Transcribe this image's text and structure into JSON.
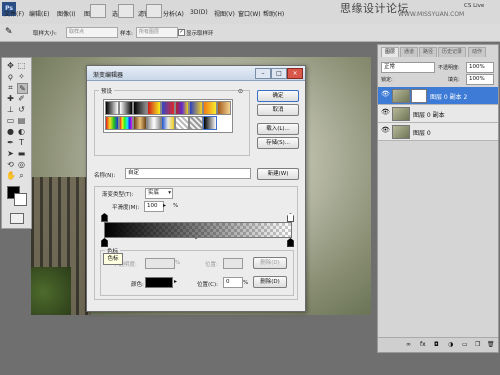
{
  "menu": [
    "文件(F)",
    "编辑(E)",
    "图像(I)",
    "图层(L)",
    "选择(S)",
    "滤镜(T)",
    "分析(A)",
    "3D(D)",
    "视图(V)",
    "窗口(W)",
    "帮助(H)"
  ],
  "watermark": {
    "main": "思缘设计论坛",
    "sub": "WWW.MISSYUAN.COM"
  },
  "cs_live": "CS Live",
  "options_bar": {
    "sample_size_label": "取样大小:",
    "sample_size_value": "取样点",
    "sample_label": "样本:",
    "sample_value": "所有图层",
    "show_ring_label": "显示取样环"
  },
  "panel": {
    "tabs": [
      "图层",
      "通道",
      "路径",
      "历史记录",
      "动作"
    ],
    "blend_mode": "正常",
    "opacity_label": "不透明度:",
    "opacity_value": "100%",
    "lock_label": "锁定:",
    "fill_label": "填充:",
    "fill_value": "100%",
    "layers": [
      {
        "name": "图层 0 副本 2",
        "selected": true
      },
      {
        "name": "图层 0 副本",
        "selected": false
      },
      {
        "name": "图层 0",
        "selected": false
      }
    ]
  },
  "dialog": {
    "title": "渐变编辑器",
    "presets_label": "预设",
    "ok": "确定",
    "cancel": "取消",
    "load": "载入(L)...",
    "save": "存储(S)...",
    "name_label": "名称(N):",
    "name_value": "自定",
    "new_button": "新建(W)",
    "gradient_type_label": "渐变类型(T):",
    "gradient_type_value": "实底",
    "smoothness_label": "平滑度(M):",
    "smoothness_value": "100",
    "smoothness_unit": "%",
    "stops_group_label": "色标",
    "tooltip": "色标",
    "opacity_label": "不透明度:",
    "opacity_unit": "%",
    "location_label": "位置:",
    "delete_label": "删除(D)",
    "color_label": "颜色:",
    "color_location_label": "位置(C):",
    "color_location_value": "0",
    "color_location_unit": "%",
    "color_delete_label": "删除(D)",
    "color_value": "#000000"
  },
  "colors": {
    "accent": "#3d7bd6",
    "foreground": "#000000",
    "background": "#ffffff"
  }
}
